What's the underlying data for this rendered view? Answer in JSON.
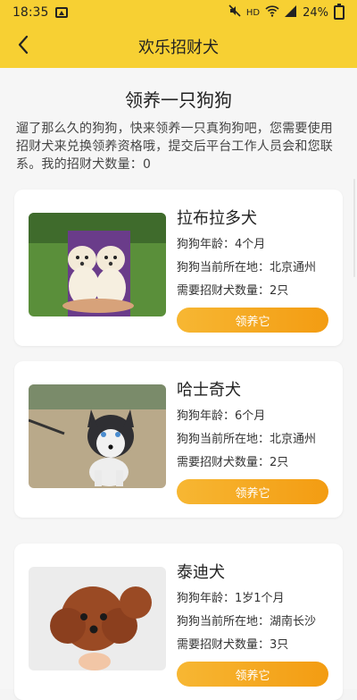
{
  "status_bar": {
    "time": "18:35",
    "right_text": "HD",
    "battery": "24%"
  },
  "nav": {
    "back_icon": "chevron-left-icon",
    "title": "欢乐招财犬"
  },
  "page": {
    "heading": "领养一只狗狗",
    "intro": "遛了那么久的狗狗，快来领养一只真狗狗吧，您需要使用招财犬来兑换领养资格哦，提交后平台工作人员会和您联系。我的招财犬数量：0"
  },
  "dogs": [
    {
      "name": "拉布拉多犬",
      "age": "狗狗年龄：4个月",
      "location": "狗狗当前所在地：北京通州",
      "need": "需要招财犬数量：2只",
      "button": "领养它"
    },
    {
      "name": "哈士奇犬",
      "age": "狗狗年龄：6个月",
      "location": "狗狗当前所在地：北京通州",
      "need": "需要招财犬数量：2只",
      "button": "领养它"
    },
    {
      "name": "泰迪犬",
      "age": "狗狗年龄：1岁1个月",
      "location": "狗狗当前所在地：湖南长沙",
      "need": "需要招财犬数量：3只",
      "button": "领养它"
    }
  ],
  "colors": {
    "brand_yellow": "#f7d033",
    "button_orange": "#f39c12"
  }
}
